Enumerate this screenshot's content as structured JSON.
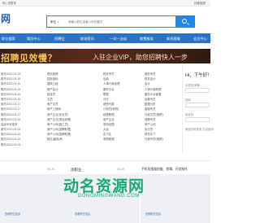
{
  "topbar": {
    "left": "网 | 请登录",
    "right": "找着客服"
  },
  "logo": "网",
  "search": {
    "select_label": "职位",
    "placeholder": "请输入职位或者公司关键字"
  },
  "nav": [
    "职位搜索",
    "简历中心",
    "招聘会",
    "职场资讯",
    "一对一洽谈",
    "收费服务",
    "联系客服",
    "会员中心"
  ],
  "banner": {
    "headline": "招聘见效慢？",
    "subline": "入驻企业VIP，助您招聘快人一步"
  },
  "leftlist": [
    "委托2023-03-19",
    "委托2023-03-19",
    "委托2023-03-19",
    "委托2023-03-19",
    "委托2023-03-19",
    "委托2023-03-19",
    "委托2023-03-17",
    "委托2023-03-17",
    "委托2023-03-17",
    "委托2023-03-10",
    "高级专家推荐",
    "委托2023-03-10",
    "委托2023-03-10",
    "委托2023-03-10",
    "委托2023-03-05"
  ],
  "col1": [
    "首页推荐",
    "招标投标",
    "建筑工程",
    "房产会计",
    "信息员",
    "文员",
    "房产文员",
    "房产工程师",
    "房产企业(安全员)",
    "房产企业(项目经理)",
    "房产公司(施工员)",
    "房产公司(招聘助理)",
    "房产公司(招聘助理)",
    "报名(最高考)"
  ],
  "col2": [
    "财务专员",
    "出纳",
    "人事行政经理",
    "服务平台",
    "联盟",
    "分行",
    "销售代表",
    "计划员(维修)",
    "经理助理",
    "房产企业",
    "采购经理",
    "大会",
    "实习生",
    "采购助理"
  ],
  "col3": [
    "服务专员",
    "财务会计",
    "会计",
    "人事行政助理",
    "服务平台客服",
    "运营专员",
    "数据分析",
    "客服专员",
    "行政文员(维修)",
    "招聘专员",
    "房产公司",
    "执行员",
    "财务实习",
    "行政专员(维修)"
  ],
  "login": {
    "greeting": "Hi，下午好！",
    "user_label": "手机号/邮箱",
    "pass_label": "密码",
    "code_label": "验证码",
    "tip": "微信扫码登录 忘记密码"
  },
  "cards": [
    {
      "date": "06-28",
      "title": "测职业",
      "tag": "查看职位信息"
    },
    {
      "date": "06-28",
      "title": "测职业",
      "tag": "查看职位信息"
    },
    {
      "date": "06-28",
      "title": "手机短视频拍摄、剪辑、开发制作",
      "tag": "查看职位信息"
    }
  ],
  "watermark": {
    "text": "动名资源网",
    "sub": "DONGMINGWANG.COM"
  }
}
